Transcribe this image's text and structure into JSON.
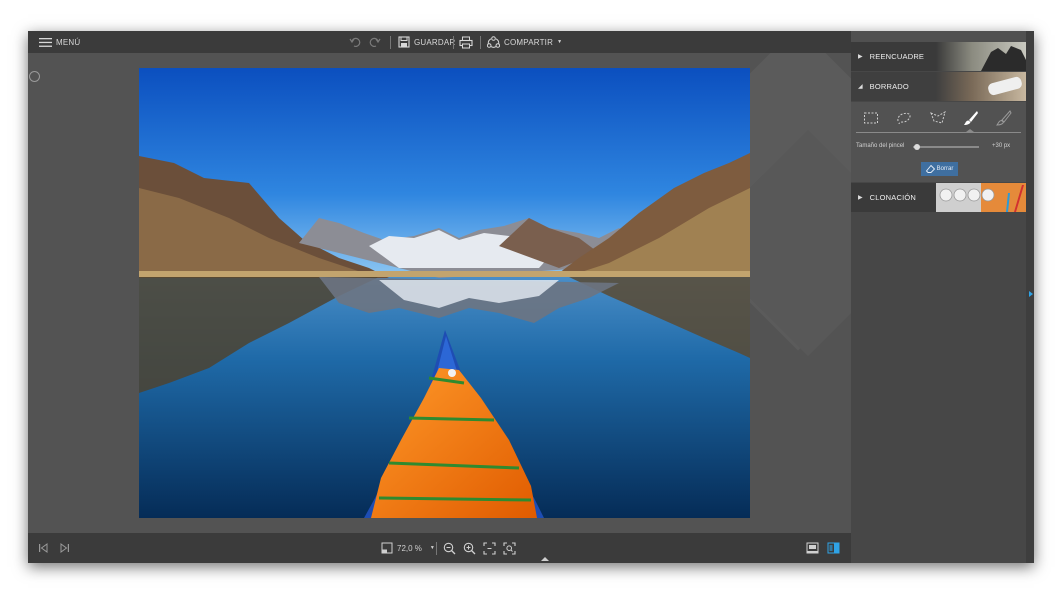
{
  "topbar": {
    "menu_label": "MENÚ",
    "save_label": "GUARDAR",
    "share_label": "COMPARTIR",
    "icons": [
      "hamburger-icon",
      "undo-icon",
      "redo-icon",
      "save-icon",
      "print-icon",
      "share-icon",
      "caret-down-icon"
    ]
  },
  "bottombar": {
    "zoom_value": "72,0 %",
    "icons": [
      "prev-icon",
      "next-icon",
      "zoom-out-icon",
      "zoom-in-icon",
      "fit-icon",
      "actual-size-icon",
      "view-single-icon",
      "view-split-icon"
    ]
  },
  "panel": {
    "recrop_label": "REENCUADRE",
    "erase_label": "BORRADO",
    "clone_label": "CLONACIÓN",
    "tools": [
      "rect-select-icon",
      "lasso-icon",
      "polygon-lasso-icon",
      "brush-icon",
      "eraser-brush-icon"
    ],
    "active_tool": "brush-icon",
    "brush_size_label": "Tamaño del pincel",
    "brush_size_value": "+30 px",
    "brush_size_fraction": 0.06,
    "erase_button_label": "Borrar"
  },
  "colors": {
    "accent": "#2fa3e6",
    "button": "#3f6fa0",
    "toolbar": "#3b3b3b",
    "panel": "#474747"
  }
}
